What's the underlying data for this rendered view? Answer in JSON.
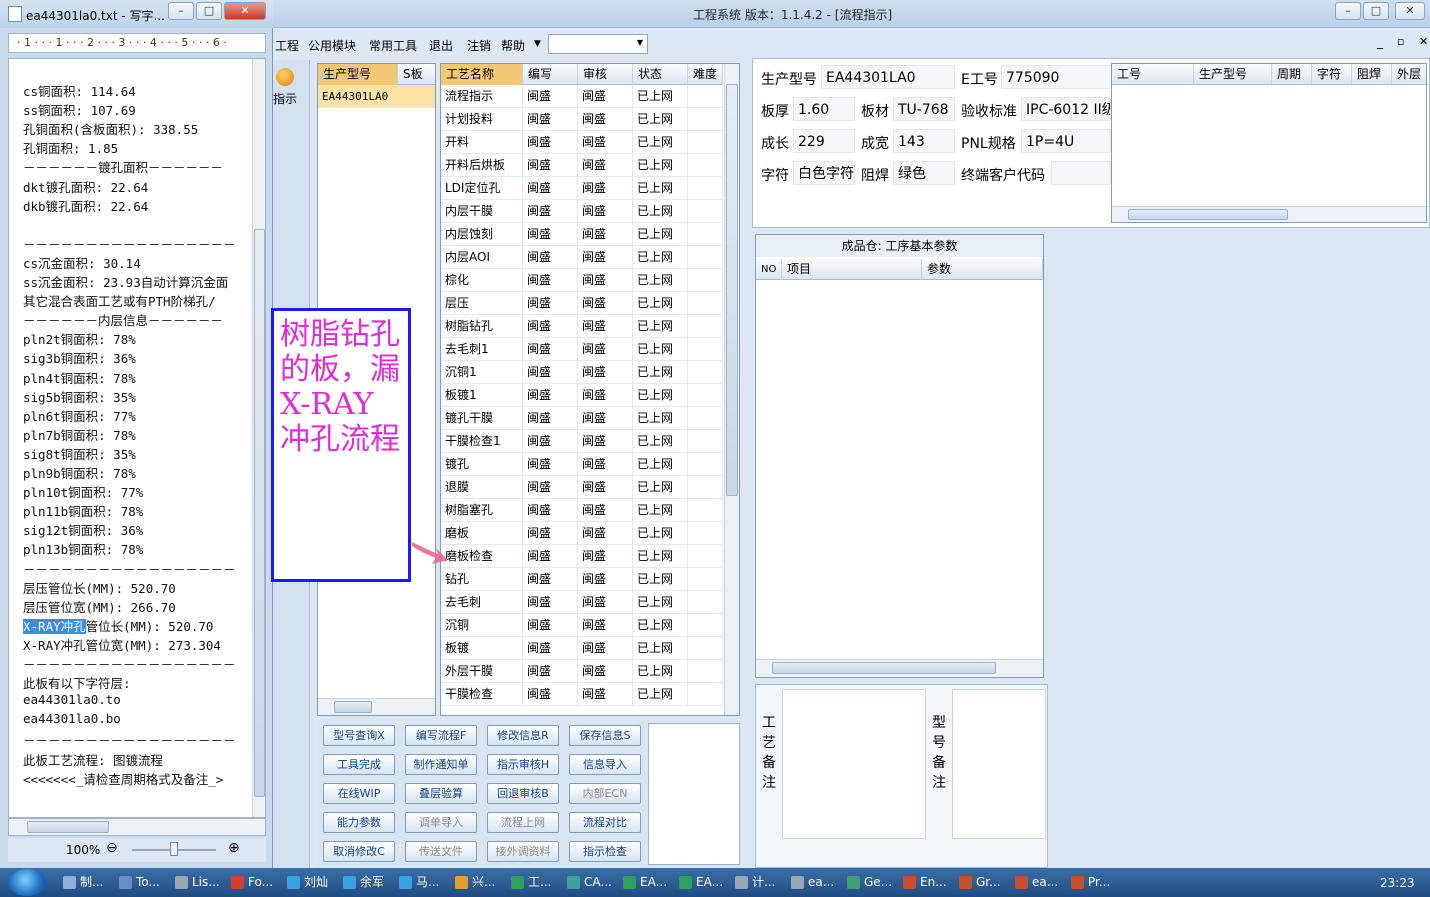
{
  "notepad": {
    "title": "ea44301la0.txt - 写字...",
    "ruler": "· 1 · · · 1 · · · 2 · · · 3 · · · 4 · · · 5 · · · 6 ·",
    "lines": [
      "cs铜面积: 114.64",
      "ss铜面积: 107.69",
      "孔铜面积(含板面积): 338.55",
      "孔铜面积: 1.85",
      "－－－－－－镀孔面积－－－－－－",
      "dkt镀孔面积: 22.64",
      "dkb镀孔面积: 22.64",
      "",
      "－－－－－－－－－－－－－－－－－",
      "cs沉金面积: 30.14",
      "ss沉金面积: 23.93自动计算沉金面",
      "其它混合表面工艺或有PTH阶梯孔/",
      "－－－－－－内层信息－－－－－－",
      "pln2t铜面积: 78%",
      "sig3b铜面积: 36%",
      "pln4t铜面积: 78%",
      "sig5b铜面积: 35%",
      "pln6t铜面积: 77%",
      "pln7b铜面积: 78%",
      "sig8t铜面积: 35%",
      "pln9b铜面积: 78%",
      "pln10t铜面积: 77%",
      "pln11b铜面积: 78%",
      "sig12t铜面积: 36%",
      "pln13b铜面积: 78%",
      "－－－－－－－－－－－－－－－－－",
      "层压管位长(MM): 520.70",
      "层压管位宽(MM): 266.70",
      "",
      "X-RAY冲孔管位宽(MM): 273.304",
      "－－－－－－－－－－－－－－－－－",
      "此板有以下字符层:",
      "ea44301la0.to",
      "ea44301la0.bo",
      "－－－－－－－－－－－－－－－－－",
      "此板工艺流程: 图镀流程",
      "<<<<<<<_请检查周期格式及备注_>"
    ],
    "highlight_line": {
      "selected": "X-RAY冲孔",
      "rest": "管位长(MM): 520.70"
    },
    "zoom": "100%"
  },
  "annotation": "树脂钻孔的板，漏X-RAY冲孔流程",
  "app": {
    "title": "工程系统   版本：1.1.4.2 - [流程指示]",
    "menu": [
      "工程",
      "公用模块",
      "常用工具",
      "退出",
      "注销",
      "帮助"
    ],
    "side_label": "指示",
    "model_grid": {
      "headers": [
        "生产型号",
        "S板"
      ],
      "rows": [
        "EA44301LA0"
      ]
    },
    "process_grid": {
      "headers": [
        "工艺名称",
        "编写",
        "审核",
        "状态",
        "难度"
      ],
      "rows": [
        [
          "流程指示",
          "闽盛",
          "闽盛",
          "已上网"
        ],
        [
          "计划投料",
          "闽盛",
          "闽盛",
          "已上网"
        ],
        [
          "开料",
          "闽盛",
          "闽盛",
          "已上网"
        ],
        [
          "开料后烘板",
          "闽盛",
          "闽盛",
          "已上网"
        ],
        [
          "LDI定位孔",
          "闽盛",
          "闽盛",
          "已上网"
        ],
        [
          "内层干膜",
          "闽盛",
          "闽盛",
          "已上网"
        ],
        [
          "内层蚀刻",
          "闽盛",
          "闽盛",
          "已上网"
        ],
        [
          "内层AOI",
          "闽盛",
          "闽盛",
          "已上网"
        ],
        [
          "棕化",
          "闽盛",
          "闽盛",
          "已上网"
        ],
        [
          "层压",
          "闽盛",
          "闽盛",
          "已上网"
        ],
        [
          "树脂钻孔",
          "闽盛",
          "闽盛",
          "已上网"
        ],
        [
          "去毛刺1",
          "闽盛",
          "闽盛",
          "已上网"
        ],
        [
          "沉铜1",
          "闽盛",
          "闽盛",
          "已上网"
        ],
        [
          "板镀1",
          "闽盛",
          "闽盛",
          "已上网"
        ],
        [
          "镀孔干膜",
          "闽盛",
          "闽盛",
          "已上网"
        ],
        [
          "干膜检查1",
          "闽盛",
          "闽盛",
          "已上网"
        ],
        [
          "镀孔",
          "闽盛",
          "闽盛",
          "已上网"
        ],
        [
          "退膜",
          "闽盛",
          "闽盛",
          "已上网"
        ],
        [
          "树脂塞孔",
          "闽盛",
          "闽盛",
          "已上网"
        ],
        [
          "磨板",
          "闽盛",
          "闽盛",
          "已上网"
        ],
        [
          "磨板检查",
          "闽盛",
          "闽盛",
          "已上网"
        ],
        [
          "钻孔",
          "闽盛",
          "闽盛",
          "已上网"
        ],
        [
          "去毛刺",
          "闽盛",
          "闽盛",
          "已上网"
        ],
        [
          "沉铜",
          "闽盛",
          "闽盛",
          "已上网"
        ],
        [
          "板镀",
          "闽盛",
          "闽盛",
          "已上网"
        ],
        [
          "外层干膜",
          "闽盛",
          "闽盛",
          "已上网"
        ],
        [
          "干膜检查",
          "闽盛",
          "闽盛",
          "已上网"
        ]
      ]
    },
    "buttons": [
      [
        "型号查询X",
        "编写流程F",
        "修改信息R",
        "保存信息S"
      ],
      [
        "工具完成",
        "制作通知单",
        "指示审核H",
        "信息导入"
      ],
      [
        "在线WIP",
        "叠层验算",
        "回退审核B",
        "内部ECN"
      ],
      [
        "能力参数",
        "调单导入",
        "流程上网",
        "流程对比"
      ],
      [
        "取消修改C",
        "传送文件",
        "接外调资料",
        "指示检查"
      ]
    ],
    "disabled_buttons": [
      "内部ECN",
      "调单导入",
      "流程上网",
      "传送文件",
      "接外调资料"
    ],
    "info": {
      "model_label": "生产型号",
      "model": "EA44301LA0",
      "eno_label": "E工号",
      "eno": "775090",
      "thickness_label": "板厚",
      "thickness": "1.60",
      "material_label": "板材",
      "material": "TU-768",
      "standard_label": "验收标准",
      "standard": "IPC-6012 II级",
      "length_label": "成长",
      "length": "229",
      "width_label": "成宽",
      "width": "143",
      "pnl_label": "PNL规格",
      "pnl": "1P=4U",
      "char_label": "字符",
      "char": "白色字符",
      "mask_label": "阻焊",
      "mask": "绿色",
      "customer_label": "终端客户代码",
      "customer": ""
    },
    "right_grid_headers": [
      "工号",
      "生产型号",
      "周期",
      "字符",
      "阻焊",
      "外层"
    ],
    "params_panel": {
      "title": "成品仓: 工序基本参数",
      "headers": [
        "NO",
        "项目",
        "参数"
      ]
    },
    "remark_labels": [
      "工艺备注",
      "型号备注"
    ]
  },
  "taskbar": {
    "items": [
      "制...",
      "To...",
      "Lis...",
      "Fo...",
      "刘灿",
      "余军",
      "马...",
      "兴...",
      "工...",
      "CA...",
      "EA...",
      "EA...",
      "计...",
      "ea...",
      "Ge...",
      "En...",
      "Gr...",
      "ea...",
      "Pr..."
    ],
    "clock": "23:23"
  }
}
